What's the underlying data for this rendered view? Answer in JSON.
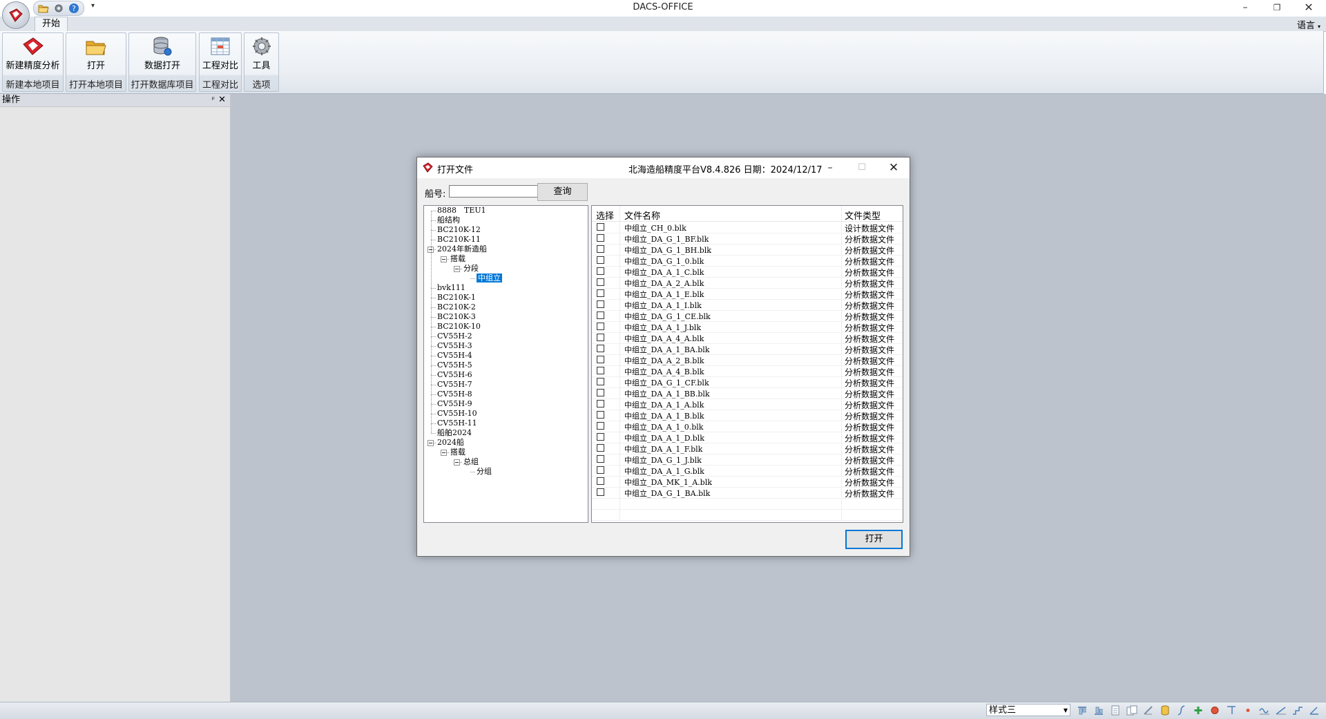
{
  "window": {
    "title": "DACS-OFFICE",
    "minimize": "–",
    "maximize": "❐",
    "close": "✕"
  },
  "qat": {
    "more": "▾"
  },
  "ribbon": {
    "tab": "开始",
    "language": "语言",
    "groups": [
      {
        "button": "新建精度分析",
        "group": "新建本地项目"
      },
      {
        "button": "打开",
        "group": "打开本地项目"
      },
      {
        "button": "数据打开",
        "group": "打开数据库项目"
      },
      {
        "button": "工程对比",
        "group": "工程对比"
      },
      {
        "button": "工具",
        "group": "选项"
      }
    ]
  },
  "panel": {
    "title": "操作",
    "pin": "ᵖ",
    "close": "✕"
  },
  "statusbar": {
    "style": "样式三"
  },
  "dialog": {
    "title": "打开文件",
    "version": "北海造船精度平台V8.4.826 日期：2024/12/17",
    "ship_label": "船号:",
    "ship_value": "",
    "query": "查询",
    "open": "打开",
    "tree": [
      {
        "label": "8888　TEU1",
        "level": 0
      },
      {
        "label": "船结构",
        "level": 0
      },
      {
        "label": "BC210K-12",
        "level": 0
      },
      {
        "label": "BC210K-11",
        "level": 0
      },
      {
        "label": "2024年新造船",
        "level": 0,
        "expanded": true
      },
      {
        "label": "搭载",
        "level": 1,
        "expanded": true
      },
      {
        "label": "分段",
        "level": 2,
        "expanded": true
      },
      {
        "label": "中组立",
        "level": 3,
        "selected": true
      },
      {
        "label": "bvk111",
        "level": 0
      },
      {
        "label": "BC210K-1",
        "level": 0
      },
      {
        "label": "BC210K-2",
        "level": 0
      },
      {
        "label": "BC210K-3",
        "level": 0
      },
      {
        "label": "BC210K-10",
        "level": 0
      },
      {
        "label": "CV55H-2",
        "level": 0
      },
      {
        "label": "CV55H-3",
        "level": 0
      },
      {
        "label": "CV55H-4",
        "level": 0
      },
      {
        "label": "CV55H-5",
        "level": 0
      },
      {
        "label": "CV55H-6",
        "level": 0
      },
      {
        "label": "CV55H-7",
        "level": 0
      },
      {
        "label": "CV55H-8",
        "level": 0
      },
      {
        "label": "CV55H-9",
        "level": 0
      },
      {
        "label": "CV55H-10",
        "level": 0
      },
      {
        "label": "CV55H-11",
        "level": 0
      },
      {
        "label": "船舶2024",
        "level": 0
      },
      {
        "label": "2024船",
        "level": 0,
        "expanded": true
      },
      {
        "label": "搭载",
        "level": 1,
        "expanded": true
      },
      {
        "label": "总组",
        "level": 2,
        "expanded": true
      },
      {
        "label": "分组",
        "level": 3
      }
    ],
    "columns": {
      "select": "选择",
      "name": "文件名称",
      "type": "文件类型"
    },
    "files": [
      {
        "name": "中组立_CH_0.blk",
        "type": "设计数据文件"
      },
      {
        "name": "中组立_DA_G_1_BF.blk",
        "type": "分析数据文件"
      },
      {
        "name": "中组立_DA_G_1_BH.blk",
        "type": "分析数据文件"
      },
      {
        "name": "中组立_DA_G_1_0.blk",
        "type": "分析数据文件"
      },
      {
        "name": "中组立_DA_A_1_C.blk",
        "type": "分析数据文件"
      },
      {
        "name": "中组立_DA_A_2_A.blk",
        "type": "分析数据文件"
      },
      {
        "name": "中组立_DA_A_1_E.blk",
        "type": "分析数据文件"
      },
      {
        "name": "中组立_DA_A_1_I.blk",
        "type": "分析数据文件"
      },
      {
        "name": "中组立_DA_G_1_CE.blk",
        "type": "分析数据文件"
      },
      {
        "name": "中组立_DA_A_1_J.blk",
        "type": "分析数据文件"
      },
      {
        "name": "中组立_DA_A_4_A.blk",
        "type": "分析数据文件"
      },
      {
        "name": "中组立_DA_A_1_BA.blk",
        "type": "分析数据文件"
      },
      {
        "name": "中组立_DA_A_2_B.blk",
        "type": "分析数据文件"
      },
      {
        "name": "中组立_DA_A_4_B.blk",
        "type": "分析数据文件"
      },
      {
        "name": "中组立_DA_G_1_CF.blk",
        "type": "分析数据文件"
      },
      {
        "name": "中组立_DA_A_1_BB.blk",
        "type": "分析数据文件"
      },
      {
        "name": "中组立_DA_A_1_A.blk",
        "type": "分析数据文件"
      },
      {
        "name": "中组立_DA_A_1_B.blk",
        "type": "分析数据文件"
      },
      {
        "name": "中组立_DA_A_1_0.blk",
        "type": "分析数据文件"
      },
      {
        "name": "中组立_DA_A_1_D.blk",
        "type": "分析数据文件"
      },
      {
        "name": "中组立_DA_A_1_F.blk",
        "type": "分析数据文件"
      },
      {
        "name": "中组立_DA_G_1_J.blk",
        "type": "分析数据文件"
      },
      {
        "name": "中组立_DA_A_1_G.blk",
        "type": "分析数据文件"
      },
      {
        "name": "中组立_DA_MK_1_A.blk",
        "type": "分析数据文件"
      },
      {
        "name": "中组立_DA_G_1_BA.blk",
        "type": "分析数据文件"
      }
    ]
  },
  "colors": {
    "accent": "#0078d7",
    "workspace": "#bcc3cd",
    "brand_red": "#d8242b"
  }
}
